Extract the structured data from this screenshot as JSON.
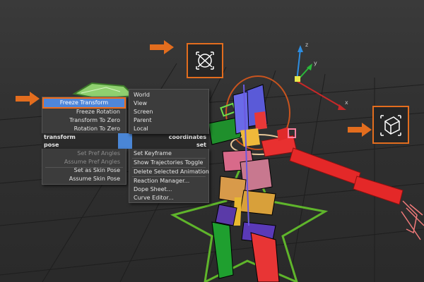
{
  "menus": {
    "left": {
      "items": [
        {
          "label": "Freeze Transform",
          "highlighted": true
        },
        {
          "label": "Freeze Rotation"
        },
        {
          "label": "Transform To Zero"
        },
        {
          "label": "Rotation To Zero"
        }
      ],
      "transform_label": "transform",
      "coordinates_label": "coordinates",
      "pose_label": "pose",
      "set_label": "set",
      "pose_items": [
        {
          "label": "Set Pref Angles",
          "disabled": true
        },
        {
          "label": "Assume Pref Angles",
          "disabled": true
        },
        {
          "label": "Set as Skin Pose"
        },
        {
          "label": "Assume Skin Pose"
        }
      ]
    },
    "right": {
      "coordinate_items": [
        "World",
        "View",
        "Screen",
        "Parent",
        "Local"
      ],
      "set_items": [
        "Set Keyframe",
        "Show Trajectories Toggle",
        "Delete Selected Animation",
        "Reaction Manager...",
        "Dope Sheet...",
        "Curve Editor..."
      ]
    }
  },
  "colors": {
    "highlight": "#4f86d9",
    "callout": "#e36d1e",
    "menu_bg": "#3c3c3c"
  },
  "gizmo": {
    "axis_x": "x",
    "axis_y": "y",
    "axis_z": "z"
  },
  "icons": [
    "arrow-right-icon",
    "freeze-transform-icon",
    "freeze-rotation-icon",
    "transform-gizmo-icon"
  ]
}
